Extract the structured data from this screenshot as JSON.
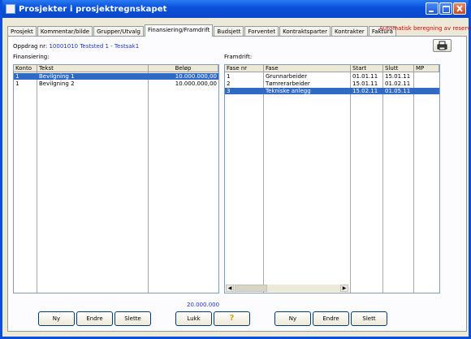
{
  "window": {
    "title": "Prosjekter i prosjektregnskapet"
  },
  "tabs": [
    {
      "label": "Prosjekt"
    },
    {
      "label": "Kommentar/bilde"
    },
    {
      "label": "Grupper/Utvalg"
    },
    {
      "label": "Finansiering/Framdrift"
    },
    {
      "label": "Budsjett"
    },
    {
      "label": "Forventet"
    },
    {
      "label": "Kontraktsparter"
    },
    {
      "label": "Kontrakter"
    },
    {
      "label": "Faktura"
    }
  ],
  "auto_calc": "Automatisk beregning av reserver!",
  "oppdrag": {
    "label": "Oppdrag nr:",
    "number": "10001010",
    "name": "Teststed 1 - Testsak1"
  },
  "financing": {
    "label": "Finansiering:",
    "columns": [
      "Konto",
      "Tekst",
      "Beløp"
    ],
    "rows": [
      {
        "konto": "1",
        "tekst": "Bevilgning 1",
        "belop": "10.000.000,00"
      },
      {
        "konto": "1",
        "tekst": "Bevilgning 2",
        "belop": "10.000.000,00"
      }
    ],
    "total": "20.000.000"
  },
  "progress": {
    "label": "Framdrift:",
    "columns": [
      "Fase nr",
      "Fase",
      "Start",
      "Slutt",
      "MP"
    ],
    "rows": [
      {
        "nr": "1",
        "fase": "Grunnarbeider",
        "start": "01.01.11",
        "slutt": "15.01.11",
        "mp": ""
      },
      {
        "nr": "2",
        "fase": "Tømrerarbeider",
        "start": "15.01.11",
        "slutt": "01.02.11",
        "mp": ""
      },
      {
        "nr": "3",
        "fase": "Tekniske anlegg",
        "start": "15.02.11",
        "slutt": "01.05.11",
        "mp": ""
      }
    ]
  },
  "buttons": {
    "ny": "Ny",
    "endre": "Endre",
    "slette": "Slette",
    "lukk": "Lukk",
    "help": "?",
    "ny2": "Ny",
    "endre2": "Endre",
    "slett": "Slett"
  },
  "colors": {
    "title_bar": "#0a52db",
    "selection": "#316ac5",
    "warning": "#e00000",
    "link": "#1b32c8"
  }
}
